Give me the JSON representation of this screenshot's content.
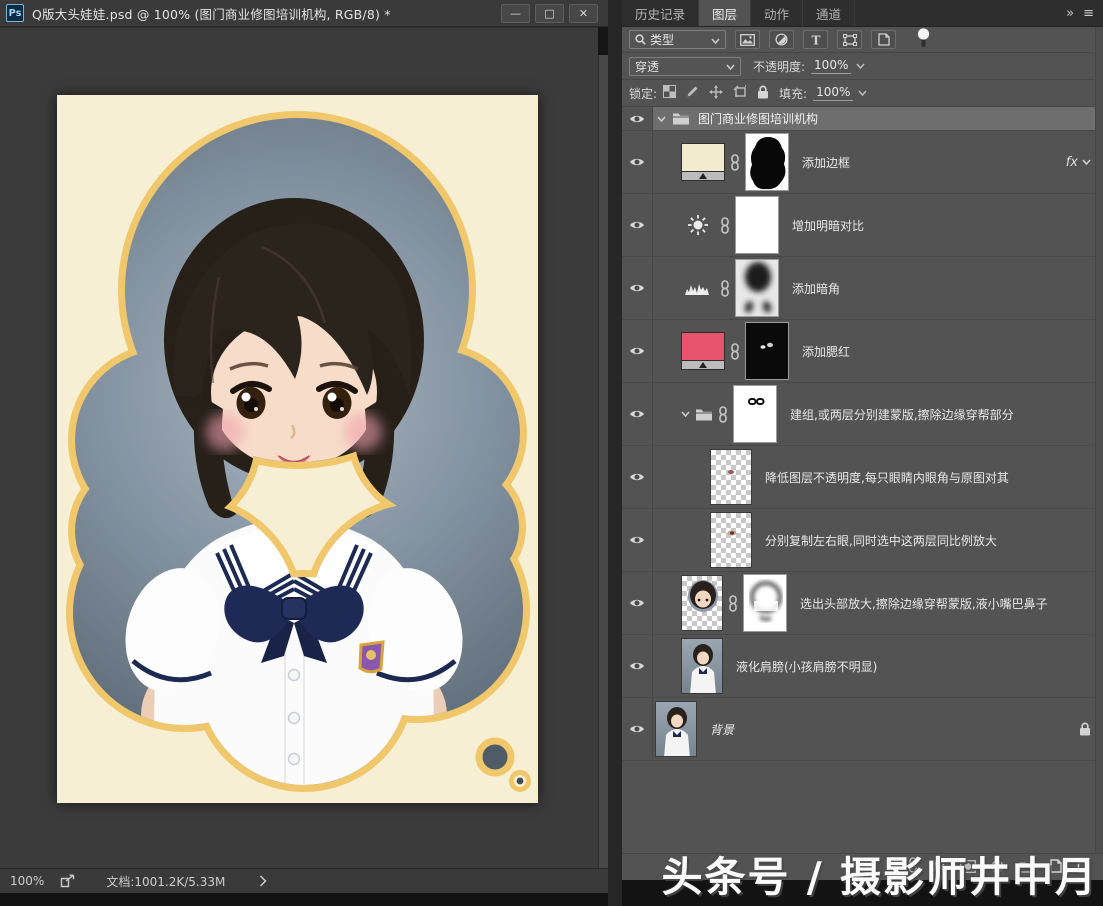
{
  "window": {
    "logo": "Ps",
    "title": "Q版大头娃娃.psd @ 100% (图门商业修图培训机构, RGB/8) *",
    "controls": {
      "minimize": "—",
      "maximize": "□",
      "close": "✕"
    }
  },
  "panel": {
    "tabs": [
      {
        "label": "历史记录",
        "active": false
      },
      {
        "label": "图层",
        "active": true
      },
      {
        "label": "动作",
        "active": false
      },
      {
        "label": "通道",
        "active": false
      }
    ],
    "filter": {
      "type_label": "类型"
    },
    "blend": {
      "mode": "穿透",
      "opacity_label": "不透明度:",
      "opacity_value": "100%"
    },
    "lock": {
      "lock_label": "锁定:",
      "fill_label": "填充:",
      "fill_value": "100%"
    }
  },
  "layers": [
    {
      "type": "group-header",
      "name": "图门商业修图培训机构",
      "selected": true,
      "expanded": true
    },
    {
      "type": "layer",
      "name": "添加边框",
      "thumb": "fill-cream",
      "mask": "black-blob",
      "link": true,
      "fx": true
    },
    {
      "type": "layer",
      "name": "增加明暗对比",
      "thumb": "icon-brightness",
      "mask": "white",
      "link": true
    },
    {
      "type": "layer",
      "name": "添加暗角",
      "thumb": "icon-curves",
      "mask": "vignette",
      "link": true
    },
    {
      "type": "layer",
      "name": "添加腮红",
      "thumb": "fill-pink",
      "mask": "black-dots",
      "link": true
    },
    {
      "type": "subgroup",
      "name": "建组,或两层分别建蒙版,擦除边缘穿帮部分",
      "mask": "white-glasses",
      "link": true
    },
    {
      "type": "layer",
      "name": "降低图层不透明度,每只眼睛内眼角与原图对其",
      "thumb": "checker-dot",
      "extra_indent": true
    },
    {
      "type": "layer",
      "name": "分别复制左右眼,同时选中这两层同比例放大",
      "thumb": "checker-eye",
      "extra_indent": true
    },
    {
      "type": "layer",
      "name": "选出头部放大,擦除边缘穿帮蒙版,液小嘴巴鼻子",
      "thumb": "photo-head",
      "mask": "white-ring",
      "link": true
    },
    {
      "type": "layer",
      "name": "液化肩膀(小孩肩膀不明显)",
      "thumb": "photo-girl"
    },
    {
      "type": "layer",
      "name": "背景",
      "thumb": "photo-girl",
      "italic": true,
      "locked": true,
      "background_layer": true
    }
  ],
  "statusbar": {
    "zoom": "100%",
    "doc_info": "文档:1001.2K/5.33M"
  },
  "watermark": "头条号 / 摄影师井中月",
  "icons": {
    "tabs_overflow": "double-chevron-right",
    "panel_menu": "hamburger",
    "filter_buttons": [
      "image-icon",
      "adjustment-icon",
      "type-icon",
      "shape-icon",
      "smart-object-icon",
      "filter-pin-toggle"
    ],
    "lock_buttons": [
      "lock-transparency-icon",
      "lock-paint-icon",
      "lock-move-icon",
      "lock-artboard-icon",
      "lock-all-icon"
    ],
    "footer_buttons": [
      "link-icon",
      "fx-icon",
      "mask-icon",
      "adjustment-icon",
      "group-icon",
      "new-layer-icon",
      "trash-icon"
    ],
    "statusbar_export": "export-icon"
  },
  "colors": {
    "accent_yellow": "#f0c76a",
    "document_cream": "#f6efd4",
    "panel_bg": "#535353",
    "selected_row": "#6e6e6e",
    "canvas_bg": "#3b3b3b",
    "blush_pink": "#e8566d"
  }
}
